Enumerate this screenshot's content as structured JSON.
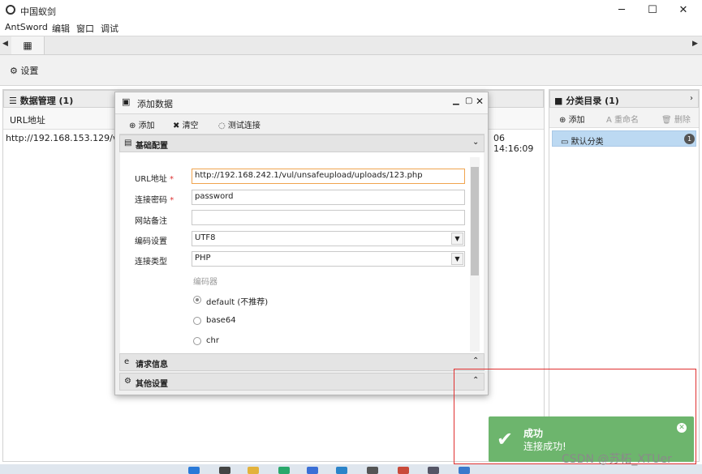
{
  "window": {
    "title": "中国蚁剑",
    "buttons": {
      "minimize": "─",
      "maximize": "☐",
      "close": "✕"
    }
  },
  "menubar": [
    "AntSword",
    "编辑",
    "窗口",
    "调试"
  ],
  "tabs": {
    "left_arrow": "◀",
    "right_arrow": "▶",
    "grid_icon": "▦"
  },
  "toolbar": {
    "settings_label": "设置"
  },
  "left_panel": {
    "title": "数据管理 (1)",
    "column_url": "URL地址",
    "row": {
      "url": "http://192.168.153.129/vul",
      "time": "06 14:16:09"
    }
  },
  "right_panel": {
    "title": "分类目录 (1)",
    "tools": {
      "add": "添加",
      "rename": "重命名",
      "delete": "删除"
    },
    "category": {
      "name": "默认分类",
      "count": "1"
    }
  },
  "dialog": {
    "title": "添加数据",
    "tools": {
      "add": "添加",
      "clear": "清空",
      "test": "测试连接"
    },
    "sections": {
      "basic": "基础配置",
      "request": "请求信息",
      "other": "其他设置"
    },
    "fields": {
      "url_label": "URL地址",
      "url_value": "http://192.168.242.1/vul/unsafeupload/uploads/123.php",
      "password_label": "连接密码",
      "password_value": "password",
      "note_label": "网站备注",
      "note_value": "",
      "encoding_label": "编码设置",
      "encoding_value": "UTF8",
      "type_label": "连接类型",
      "type_value": "PHP",
      "encoder_label": "编码器",
      "required_mark": "*"
    },
    "encoders": [
      {
        "label": "default (不推荐)",
        "checked": true
      },
      {
        "label": "base64",
        "checked": false
      },
      {
        "label": "chr",
        "checked": false
      }
    ]
  },
  "toast": {
    "title": "成功",
    "message": "连接成功!"
  },
  "watermark": "CSDN @苏柘_XTUer",
  "colors": {
    "toast": "#6db56d",
    "highlight": "#e03030",
    "selected": "#bcd9f2"
  }
}
